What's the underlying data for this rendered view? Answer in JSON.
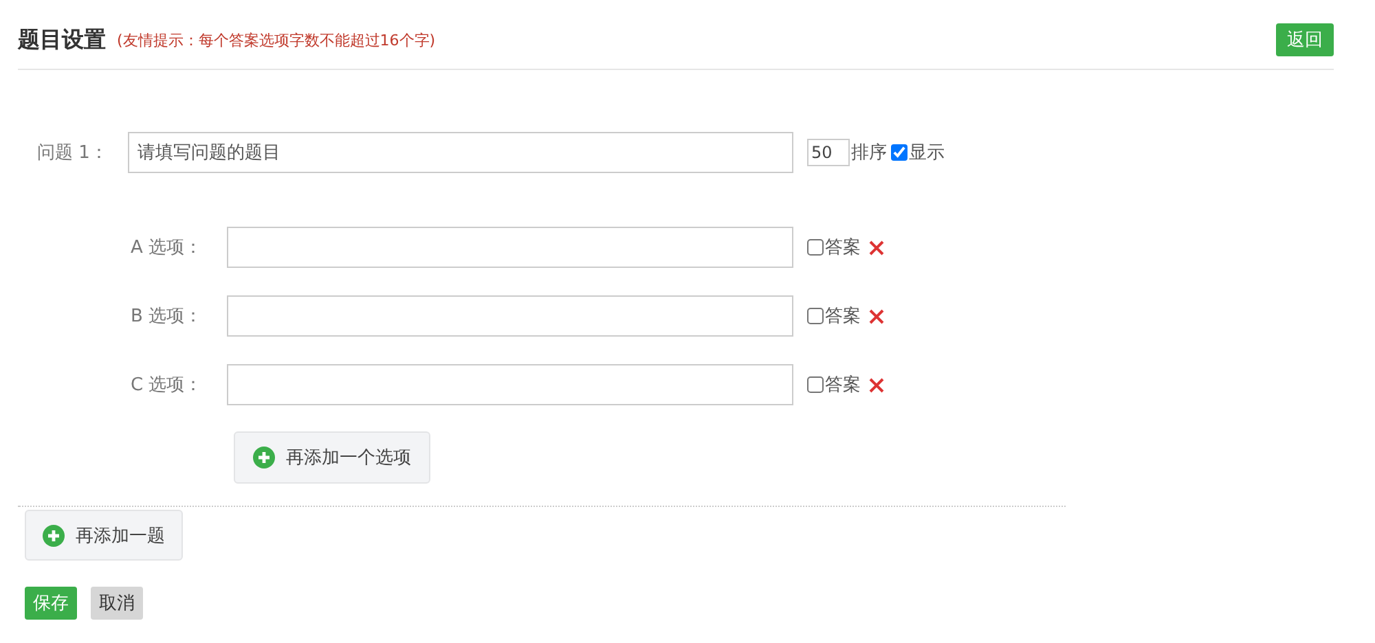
{
  "header": {
    "title": "题目设置",
    "hint": "(友情提示：每个答案选项字数不能超过16个字)",
    "back_button": "返回"
  },
  "question": {
    "label": "问题  1：",
    "placeholder": "请填写问题的题目",
    "order": "50",
    "order_label": "排序",
    "show": {
      "label": "显示",
      "checked": true
    }
  },
  "options": [
    {
      "label": "A  选项：",
      "answer_label": "答案",
      "answer_checked": false
    },
    {
      "label": "B  选项：",
      "answer_label": "答案",
      "answer_checked": false
    },
    {
      "label": "C  选项：",
      "answer_label": "答案",
      "answer_checked": false
    }
  ],
  "add_option": "再添加一个选项",
  "add_question": "再添加一题",
  "buttons": [
    {
      "label": "保存",
      "kind": "primary"
    },
    {
      "label": "取消",
      "kind": "secondary"
    }
  ]
}
